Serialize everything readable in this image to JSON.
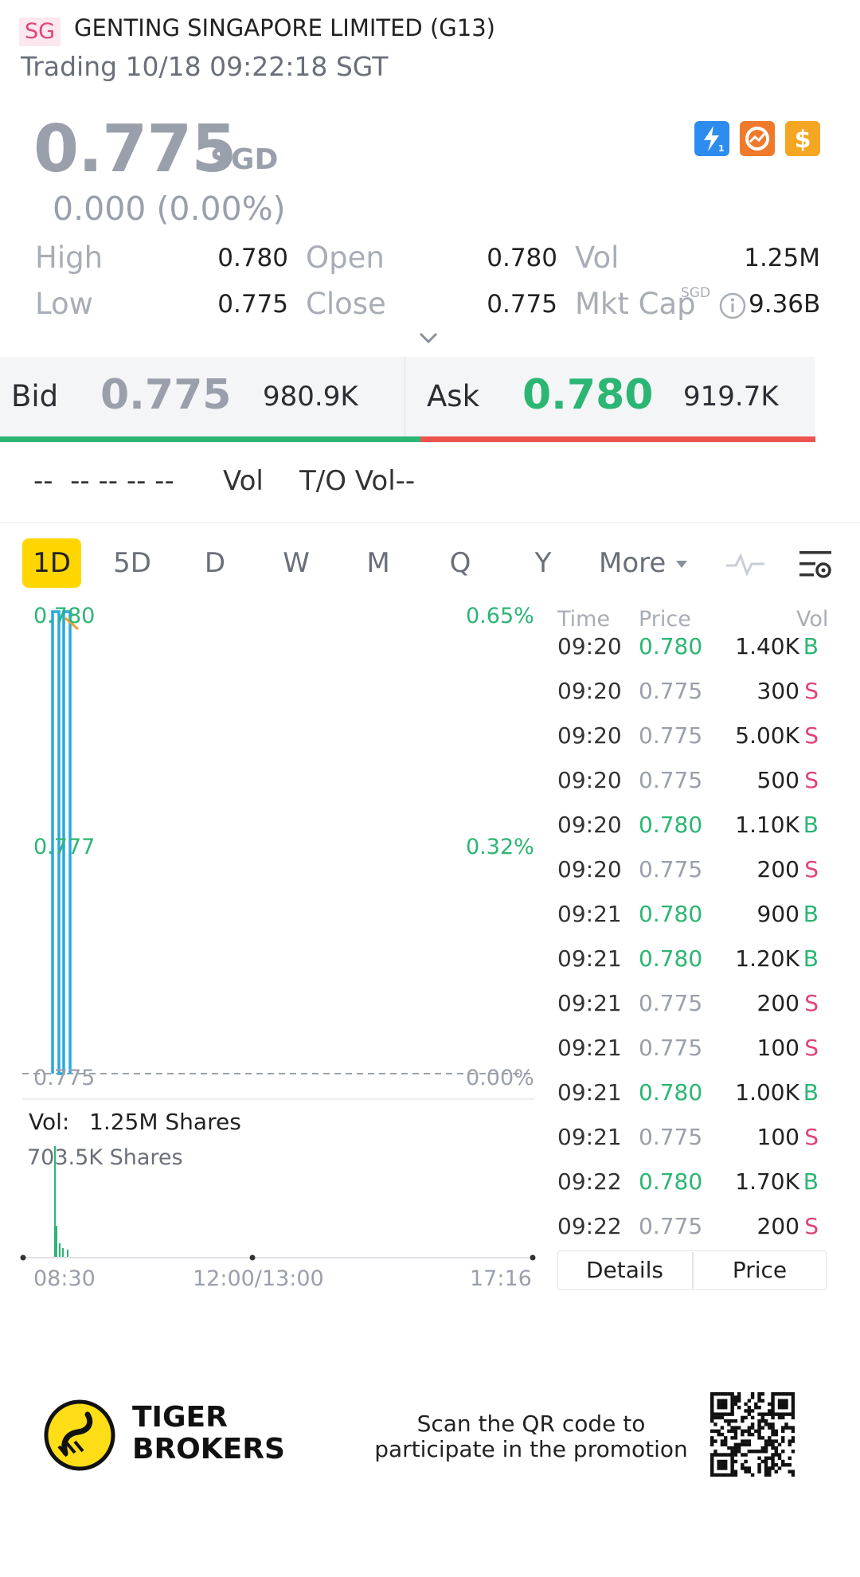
{
  "header": {
    "market_badge": "SG",
    "name": "GENTING SINGAPORE LIMITED (G13)",
    "status": "Trading 10/18 09:22:18 SGT"
  },
  "quote": {
    "price": "0.775",
    "currency": "SGD",
    "change": "0.000 (0.00%)",
    "badges": [
      {
        "icon": "lightning-level1-icon",
        "color": "#2d8cf0"
      },
      {
        "icon": "chart-bubble-icon",
        "color": "#f07a2c"
      },
      {
        "icon": "dollar-icon",
        "color": "#f5a623"
      }
    ]
  },
  "stats": {
    "high_label": "High",
    "high": "0.780",
    "low_label": "Low",
    "low": "0.775",
    "open_label": "Open",
    "open": "0.780",
    "close_label": "Close",
    "close": "0.775",
    "vol_label": "Vol",
    "vol": "1.25M",
    "mktcap_label": "Mkt Cap",
    "mktcap_currency": "SGD",
    "mktcap": "9.36B"
  },
  "bidask": {
    "bid_label": "Bid",
    "bid_price": "0.775",
    "bid_vol": "980.9K",
    "ask_label": "Ask",
    "ask_price": "0.780",
    "ask_vol": "919.7K"
  },
  "extra_row": {
    "dashes": "--  -- -- -- --",
    "vol_label": "Vol",
    "to_vol_label": "T/O Vol--"
  },
  "tabs": [
    "1D",
    "5D",
    "D",
    "W",
    "M",
    "Q",
    "Y",
    "More"
  ],
  "chart": {
    "y_top": "0.780",
    "y_mid": "0.777",
    "y_bot": "0.775",
    "pct_top": "0.65%",
    "pct_mid": "0.32%",
    "pct_bot": "0.00%",
    "vol_label": "Vol:",
    "vol_value": "1.25M Shares",
    "vol_scale": "703.5K Shares",
    "x_start": "08:30",
    "x_mid": "12:00/13:00",
    "x_end": "17:16"
  },
  "chart_data": {
    "type": "line",
    "x": [
      "09:20",
      "09:20",
      "09:20",
      "09:21",
      "09:21",
      "09:21",
      "09:22"
    ],
    "series": [
      {
        "values": [
          0.78,
          0.775,
          0.78,
          0.775,
          0.78,
          0.775,
          0.78
        ]
      }
    ],
    "ylim": [
      0.775,
      0.78
    ]
  },
  "time_sales": {
    "headers": [
      "Time",
      "Price",
      "Vol"
    ],
    "rows": [
      {
        "time": "09:20",
        "price": "0.780",
        "vol": "1.40K",
        "side": "B"
      },
      {
        "time": "09:20",
        "price": "0.775",
        "vol": "300",
        "side": "S"
      },
      {
        "time": "09:20",
        "price": "0.775",
        "vol": "5.00K",
        "side": "S"
      },
      {
        "time": "09:20",
        "price": "0.775",
        "vol": "500",
        "side": "S"
      },
      {
        "time": "09:20",
        "price": "0.780",
        "vol": "1.10K",
        "side": "B"
      },
      {
        "time": "09:20",
        "price": "0.775",
        "vol": "200",
        "side": "S"
      },
      {
        "time": "09:21",
        "price": "0.780",
        "vol": "900",
        "side": "B"
      },
      {
        "time": "09:21",
        "price": "0.780",
        "vol": "1.20K",
        "side": "B"
      },
      {
        "time": "09:21",
        "price": "0.775",
        "vol": "200",
        "side": "S"
      },
      {
        "time": "09:21",
        "price": "0.775",
        "vol": "100",
        "side": "S"
      },
      {
        "time": "09:21",
        "price": "0.780",
        "vol": "1.00K",
        "side": "B"
      },
      {
        "time": "09:21",
        "price": "0.775",
        "vol": "100",
        "side": "S"
      },
      {
        "time": "09:22",
        "price": "0.780",
        "vol": "1.70K",
        "side": "B"
      },
      {
        "time": "09:22",
        "price": "0.775",
        "vol": "200",
        "side": "S"
      }
    ],
    "tab_details": "Details",
    "tab_price": "Price"
  },
  "footer": {
    "brand_line1": "TIGER",
    "brand_line2": "BROKERS",
    "promo_line1": "Scan the QR code to",
    "promo_line2": "participate in the promotion"
  },
  "colors": {
    "buy": "#2bb673",
    "sell": "#e0447a",
    "neutral": "#9aa0ab",
    "chart_line": "#29a9e0",
    "active_tab": "#ffd600"
  }
}
